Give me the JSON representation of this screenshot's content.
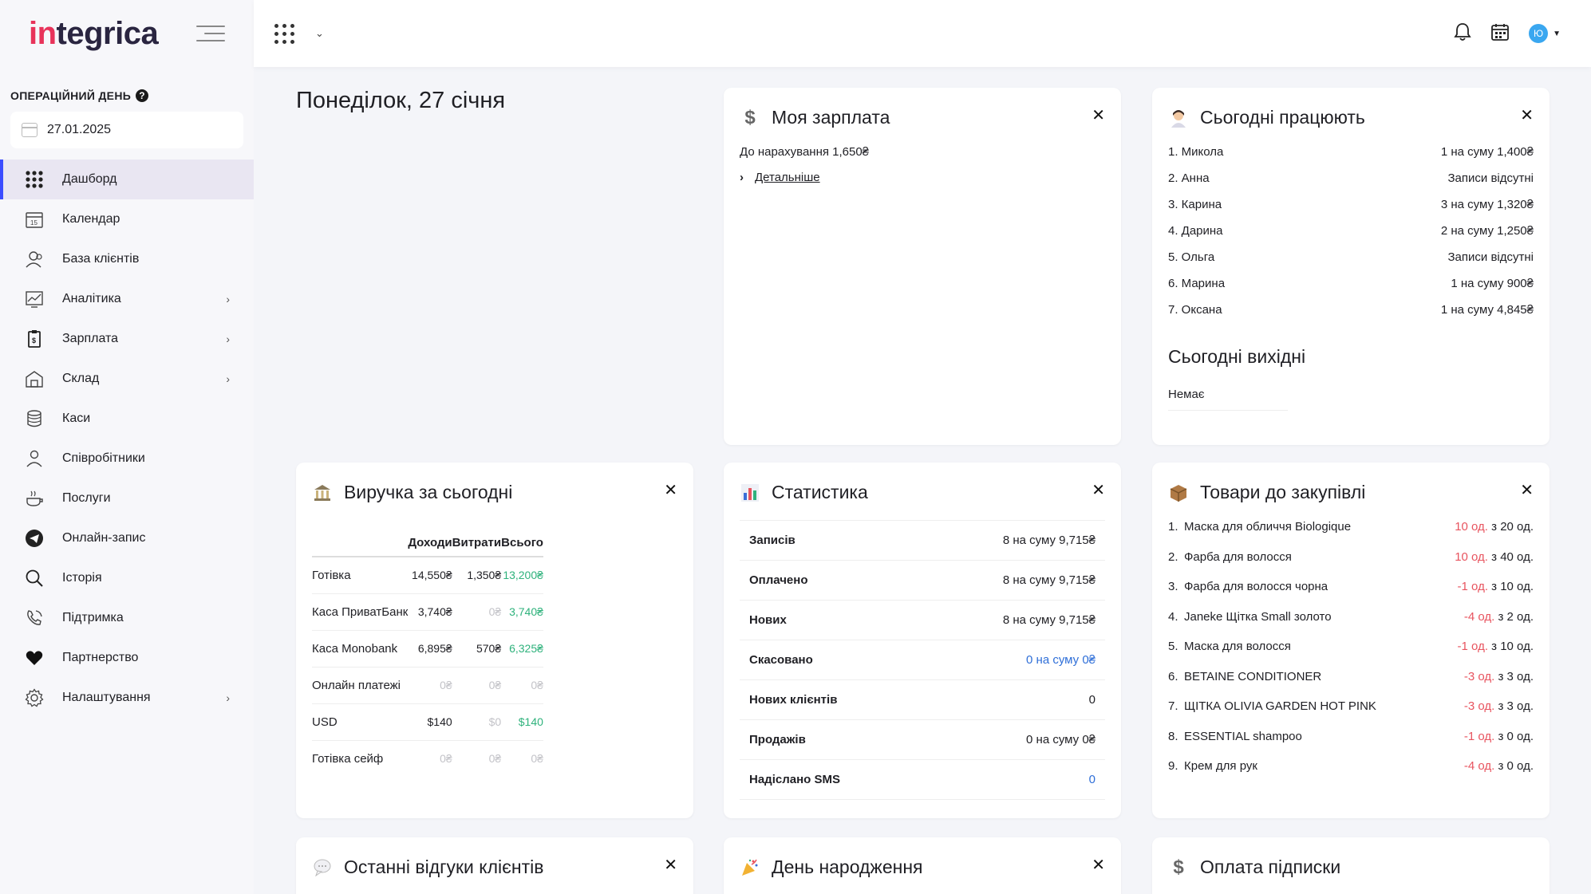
{
  "brand": {
    "logo_left": "in",
    "logo_right": "tegrica"
  },
  "sidebar": {
    "opday_label": "ОПЕРАЦІЙНИЙ ДЕНЬ",
    "date": "27.01.2025",
    "items": [
      {
        "label": "Дашборд",
        "icon": "grid-icon",
        "active": true,
        "chevron": false
      },
      {
        "label": "Календар",
        "icon": "calendar-icon",
        "chevron": false
      },
      {
        "label": "База клієнтів",
        "icon": "clients-icon",
        "chevron": false
      },
      {
        "label": "Аналітика",
        "icon": "analytics-icon",
        "chevron": true
      },
      {
        "label": "Зарплата",
        "icon": "salary-icon",
        "chevron": true
      },
      {
        "label": "Склад",
        "icon": "warehouse-icon",
        "chevron": true
      },
      {
        "label": "Каси",
        "icon": "cash-icon",
        "chevron": false
      },
      {
        "label": "Співробітники",
        "icon": "staff-icon",
        "chevron": false
      },
      {
        "label": "Послуги",
        "icon": "services-icon",
        "chevron": false
      },
      {
        "label": "Онлайн-запис",
        "icon": "online-booking-icon",
        "chevron": false
      },
      {
        "label": "Історія",
        "icon": "history-icon",
        "chevron": false
      },
      {
        "label": "Підтримка",
        "icon": "support-icon",
        "chevron": false
      },
      {
        "label": "Партнерство",
        "icon": "heart-icon",
        "chevron": false
      },
      {
        "label": "Налаштування",
        "icon": "settings-icon",
        "chevron": true
      }
    ]
  },
  "topbar": {
    "avatar": "Ю"
  },
  "page": {
    "title": "Понеділок, 27 січня"
  },
  "salary": {
    "title": "Моя зарплата",
    "line": "До нарахування 1,650₴",
    "more": "Детальніше"
  },
  "working": {
    "title": "Сьогодні працюють",
    "rows": [
      {
        "name": "1. Микола",
        "value": "1 на суму 1,400₴"
      },
      {
        "name": "2. Анна",
        "value": "Записи відсутні"
      },
      {
        "name": "3. Карина",
        "value": "3 на суму 1,320₴"
      },
      {
        "name": "4. Дарина",
        "value": "2 на суму 1,250₴"
      },
      {
        "name": "5. Ольга",
        "value": "Записи відсутні"
      },
      {
        "name": "6. Марина",
        "value": "1 на суму 900₴"
      },
      {
        "name": "7. Оксана",
        "value": "1 на суму 4,845₴"
      }
    ],
    "weekend_title": "Сьогодні вихідні",
    "weekend_none": "Немає"
  },
  "revenue": {
    "title": "Виручка за сьогодні",
    "headers": [
      "",
      "Доходи",
      "Витрати",
      "Всього"
    ],
    "rows": [
      {
        "name": "Готівка",
        "income": "14,550₴",
        "expense": "1,350₴",
        "total": "13,200₴",
        "income_muted": false,
        "expense_muted": false,
        "total_muted": false
      },
      {
        "name": "Каса ПриватБанк",
        "income": "3,740₴",
        "expense": "0₴",
        "total": "3,740₴",
        "income_muted": false,
        "expense_muted": true,
        "total_muted": false
      },
      {
        "name": "Каса Monobank",
        "income": "6,895₴",
        "expense": "570₴",
        "total": "6,325₴",
        "income_muted": false,
        "expense_muted": false,
        "total_muted": false
      },
      {
        "name": "Онлайн платежі",
        "income": "0₴",
        "expense": "0₴",
        "total": "0₴",
        "income_muted": true,
        "expense_muted": true,
        "total_muted": true
      },
      {
        "name": "USD",
        "income": "$140",
        "expense": "$0",
        "total": "$140",
        "income_muted": false,
        "expense_muted": true,
        "total_muted": false
      },
      {
        "name": "Готівка сейф",
        "income": "0₴",
        "expense": "0₴",
        "total": "0₴",
        "income_muted": true,
        "expense_muted": true,
        "total_muted": true
      }
    ]
  },
  "stats": {
    "title": "Статистика",
    "rows": [
      {
        "label": "Записів",
        "value": "8 на суму 9,715₴",
        "blue": false
      },
      {
        "label": "Оплачено",
        "value": "8 на суму 9,715₴",
        "blue": false
      },
      {
        "label": "Нових",
        "value": "8 на суму 9,715₴",
        "blue": false
      },
      {
        "label": "Скасовано",
        "value": "0 на суму 0₴",
        "blue": true
      },
      {
        "label": "Нових клієнтів",
        "value": "0",
        "blue": false
      },
      {
        "label": "Продажів",
        "value": "0 на суму 0₴",
        "blue": false
      },
      {
        "label": "Надіслано SMS",
        "value": "0",
        "blue": true
      }
    ]
  },
  "goods": {
    "title": "Товари до закупівлі",
    "rows": [
      {
        "n": "1.",
        "name": "Маска для обличчя Biologique",
        "qty": "10 од.",
        "of": "з 20 од."
      },
      {
        "n": "2.",
        "name": "Фарба для волосся",
        "qty": "10 од.",
        "of": "з 40 од."
      },
      {
        "n": "3.",
        "name": "Фарба для волосся чорна",
        "qty": "-1 од.",
        "of": "з 10 од."
      },
      {
        "n": "4.",
        "name": "Janeke Щітка Small золото",
        "qty": "-4 од.",
        "of": "з 2 од."
      },
      {
        "n": "5.",
        "name": "Маска для волосся",
        "qty": "-1 од.",
        "of": "з 10 од."
      },
      {
        "n": "6.",
        "name": "BETAINE CONDITIONER",
        "qty": "-3 од.",
        "of": "з 3 од."
      },
      {
        "n": "7.",
        "name": "ЩІТКА OLIVIA GARDEN HOT PINK",
        "qty": "-3 од.",
        "of": "з 3 од."
      },
      {
        "n": "8.",
        "name": "ESSENTIAL shampoo",
        "qty": "-1 од.",
        "of": "з 0 од."
      },
      {
        "n": "9.",
        "name": "Крем для рук",
        "qty": "-4 од.",
        "of": "з 0 од."
      }
    ]
  },
  "reviews": {
    "title": "Останні відгуки клієнтів"
  },
  "birthday": {
    "title": "День народження"
  },
  "subscription": {
    "title": "Оплата підписки"
  },
  "colors": {
    "accent": "#3b4cff",
    "positive": "#2fb27c",
    "negative": "#e8545f",
    "link_blue": "#2f6fd8"
  }
}
